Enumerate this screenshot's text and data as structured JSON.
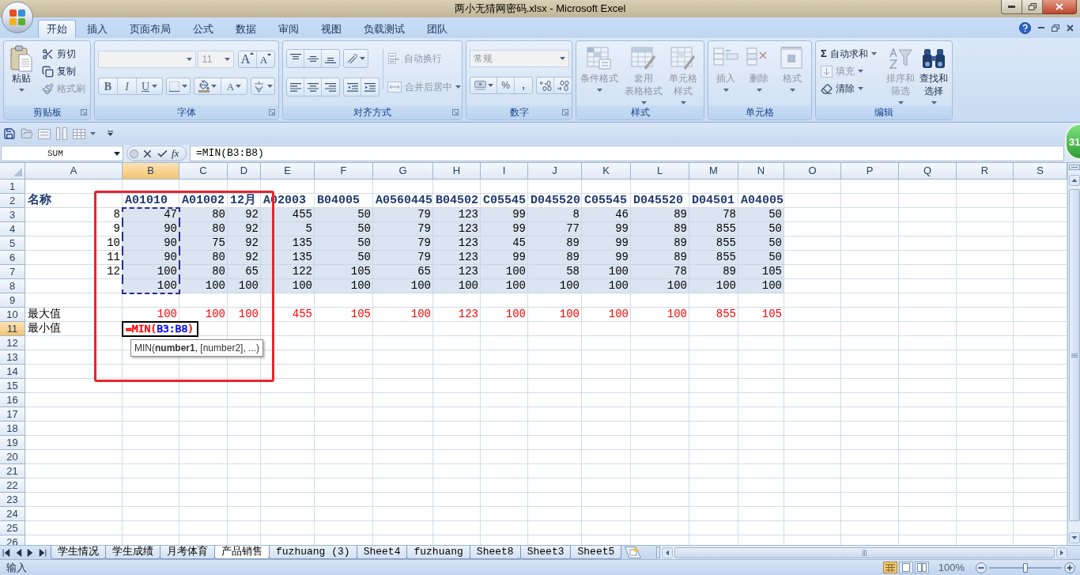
{
  "window": {
    "title": "两小无猜网密码.xlsx - Microsoft Excel"
  },
  "ribbon": {
    "tabs": [
      {
        "label": "开始",
        "selected": true
      },
      {
        "label": "插入",
        "selected": false
      },
      {
        "label": "页面布局",
        "selected": false
      },
      {
        "label": "公式",
        "selected": false
      },
      {
        "label": "数据",
        "selected": false
      },
      {
        "label": "审阅",
        "selected": false
      },
      {
        "label": "视图",
        "selected": false
      },
      {
        "label": "负载测试",
        "selected": false
      },
      {
        "label": "团队",
        "selected": false
      }
    ],
    "groups": [
      {
        "kind": "clipboard",
        "title": "剪贴板",
        "paste": {
          "lines": [
            "粘贴"
          ],
          "disabled": false
        },
        "commands": [
          {
            "label": "剪切",
            "disabled": false
          },
          {
            "label": "复制",
            "disabled": false
          },
          {
            "label": "格式刷",
            "disabled": true
          }
        ]
      },
      {
        "kind": "font",
        "title": "字体",
        "font_size": "11",
        "grow": "A",
        "shrink": "A",
        "bold": "B",
        "italic": "I",
        "underline": "U",
        "font_color": "A"
      },
      {
        "kind": "alignment",
        "title": "对齐方式",
        "commands": [
          {
            "label": "自动换行",
            "disabled": true
          },
          {
            "label": "合并后居中",
            "disabled": true
          }
        ]
      },
      {
        "kind": "number",
        "title": "数字",
        "format": "常规",
        "percent": "%",
        "comma": ","
      },
      {
        "kind": "styles",
        "title": "样式",
        "commands": [
          {
            "lines": [
              "条件格式"
            ],
            "disabled": true
          },
          {
            "lines": [
              "套用",
              "表格格式"
            ],
            "disabled": true
          },
          {
            "lines": [
              "单元格",
              "样式"
            ],
            "disabled": true
          }
        ]
      },
      {
        "kind": "cells",
        "title": "单元格",
        "commands": [
          {
            "lines": [
              "插入"
            ],
            "disabled": true
          },
          {
            "lines": [
              "删除"
            ],
            "disabled": true
          },
          {
            "lines": [
              "格式"
            ],
            "disabled": true
          }
        ]
      },
      {
        "kind": "editing",
        "title": "编辑",
        "commands": [
          {
            "symbol": "Σ",
            "label": "自动求和",
            "disabled": false
          },
          {
            "label": "填充",
            "disabled": true
          },
          {
            "label": "清除",
            "disabled": false
          }
        ],
        "large": [
          {
            "lines": [
              "排序和",
              "筛选"
            ],
            "disabled": true
          },
          {
            "lines": [
              "查找和",
              "选择"
            ],
            "disabled": false
          }
        ]
      }
    ]
  },
  "formula_bar": {
    "name_box": "SUM",
    "fx": "fx",
    "formula": "=MIN(B3:B8)"
  },
  "sheet": {
    "columns": [
      {
        "label": "A",
        "selected": false
      },
      {
        "label": "B",
        "selected": true
      },
      {
        "label": "C",
        "selected": false
      },
      {
        "label": "D",
        "selected": false
      },
      {
        "label": "E",
        "selected": false
      },
      {
        "label": "F",
        "selected": false
      },
      {
        "label": "G",
        "selected": false
      },
      {
        "label": "H",
        "selected": false
      },
      {
        "label": "I",
        "selected": false
      },
      {
        "label": "J",
        "selected": false
      },
      {
        "label": "K",
        "selected": false
      },
      {
        "label": "L",
        "selected": false
      },
      {
        "label": "M",
        "selected": false
      },
      {
        "label": "N",
        "selected": false
      },
      {
        "label": "O",
        "selected": false
      },
      {
        "label": "P",
        "selected": false
      },
      {
        "label": "Q",
        "selected": false
      },
      {
        "label": "R",
        "selected": false
      },
      {
        "label": "S",
        "selected": false
      }
    ],
    "rows": [
      {
        "label": "1",
        "selected": false,
        "referenced": false,
        "kind": "blank"
      },
      {
        "label": "2",
        "selected": false,
        "referenced": false,
        "kind": "header",
        "cells": [
          "名称",
          "A01010",
          "A01002",
          "12月",
          "A02003",
          "B04005",
          "A0560445",
          "B04502",
          "C05545",
          "D045520",
          "C05545",
          "D045520",
          "D04501",
          "A04005"
        ]
      },
      {
        "label": "3",
        "selected": false,
        "referenced": true,
        "kind": "data",
        "cells": [
          "8",
          "47",
          "80",
          "92",
          "455",
          "50",
          "79",
          "123",
          "99",
          "8",
          "46",
          "89",
          "78",
          "50"
        ]
      },
      {
        "label": "4",
        "selected": false,
        "referenced": true,
        "kind": "data",
        "cells": [
          "9",
          "90",
          "80",
          "92",
          "5",
          "50",
          "79",
          "123",
          "99",
          "77",
          "99",
          "89",
          "855",
          "50"
        ]
      },
      {
        "label": "5",
        "selected": false,
        "referenced": true,
        "kind": "data",
        "cells": [
          "10",
          "90",
          "75",
          "92",
          "135",
          "50",
          "79",
          "123",
          "45",
          "89",
          "99",
          "89",
          "855",
          "50"
        ]
      },
      {
        "label": "6",
        "selected": false,
        "referenced": true,
        "kind": "data",
        "cells": [
          "11",
          "90",
          "80",
          "92",
          "135",
          "50",
          "79",
          "123",
          "99",
          "89",
          "99",
          "89",
          "855",
          "50"
        ]
      },
      {
        "label": "7",
        "selected": false,
        "referenced": true,
        "kind": "data",
        "cells": [
          "12",
          "100",
          "80",
          "65",
          "122",
          "105",
          "65",
          "123",
          "100",
          "58",
          "100",
          "78",
          "89",
          "105"
        ]
      },
      {
        "label": "8",
        "selected": false,
        "referenced": true,
        "kind": "data",
        "cells": [
          null,
          "100",
          "100",
          "100",
          "100",
          "100",
          "100",
          "100",
          "100",
          "100",
          "100",
          "100",
          "100",
          "100"
        ]
      },
      {
        "label": "9",
        "selected": false,
        "referenced": false,
        "kind": "blank"
      },
      {
        "label": "10",
        "selected": false,
        "referenced": false,
        "kind": "total",
        "cells": [
          "最大值",
          "100",
          "100",
          "100",
          "455",
          "105",
          "100",
          "123",
          "100",
          "100",
          "100",
          "100",
          "855",
          "105"
        ]
      },
      {
        "label": "11",
        "selected": true,
        "referenced": false,
        "kind": "formula",
        "cells": [
          "最小值",
          [
            {
              "text": "=MIN(",
              "color": "#ff0000"
            },
            {
              "text": "B3:B8",
              "color": "#0000ff"
            },
            {
              "text": ")",
              "color": "#ff0000"
            }
          ]
        ]
      },
      {
        "label": "12",
        "selected": false,
        "referenced": false,
        "kind": "blank"
      },
      {
        "label": "13",
        "selected": false,
        "referenced": false,
        "kind": "blank"
      },
      {
        "label": "14",
        "selected": false,
        "referenced": false,
        "kind": "blank"
      },
      {
        "label": "15",
        "selected": false,
        "referenced": false,
        "kind": "blank"
      },
      {
        "label": "16",
        "selected": false,
        "referenced": false,
        "kind": "blank"
      },
      {
        "label": "17",
        "selected": false,
        "referenced": false,
        "kind": "blank"
      },
      {
        "label": "18",
        "selected": false,
        "referenced": false,
        "kind": "blank"
      },
      {
        "label": "19",
        "selected": false,
        "referenced": false,
        "kind": "blank"
      },
      {
        "label": "20",
        "selected": false,
        "referenced": false,
        "kind": "blank"
      },
      {
        "label": "21",
        "selected": false,
        "referenced": false,
        "kind": "blank"
      },
      {
        "label": "22",
        "selected": false,
        "referenced": false,
        "kind": "blank"
      },
      {
        "label": "23",
        "selected": false,
        "referenced": false,
        "kind": "blank"
      },
      {
        "label": "24",
        "selected": false,
        "referenced": false,
        "kind": "blank"
      },
      {
        "label": "25",
        "selected": false,
        "referenced": false,
        "kind": "blank"
      },
      {
        "label": "26",
        "selected": false,
        "referenced": false,
        "kind": "blank"
      }
    ],
    "tooltip": "MIN(**number1**, [number2], ...)"
  },
  "sheet_tabs": [
    {
      "label": "学生情况",
      "selected": false
    },
    {
      "label": "学生成绩",
      "selected": false
    },
    {
      "label": "月考体育",
      "selected": false
    },
    {
      "label": "产品销售",
      "selected": true
    },
    {
      "label": "fuzhuang (3)",
      "selected": false
    },
    {
      "label": "Sheet4",
      "selected": false
    },
    {
      "label": "fuzhuang",
      "selected": false
    },
    {
      "label": "Sheet8",
      "selected": false
    },
    {
      "label": "Sheet3",
      "selected": false
    },
    {
      "label": "Sheet5",
      "selected": false
    }
  ],
  "status_bar": {
    "mode": "输入",
    "zoom": "100%",
    "zoom_slider": {
      "level": 0.5
    }
  },
  "floating_badge": {
    "text": "31"
  }
}
